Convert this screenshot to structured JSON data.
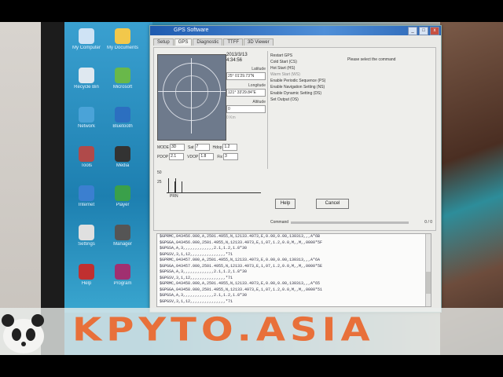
{
  "window": {
    "title": "GPS Software",
    "controls": [
      "_",
      "□",
      "x"
    ]
  },
  "tabs": [
    "Setup",
    "GPS",
    "Diagnostic",
    "TTFF",
    "3D Viewer"
  ],
  "fix_info": {
    "date": "2013/3/13",
    "time": "4:34:56",
    "latitude_label": "Latitude",
    "latitude_value": "25° 01'29.73\"N",
    "longitude_label": "Longitude",
    "longitude_value": "121° 33'29.84\"E",
    "altitude_label": "Altitude",
    "altitude_value": "0",
    "speed_text": "0  Km"
  },
  "status_row": {
    "mode_label": "MODE",
    "mode_value": "3D",
    "sats_label": "Sat",
    "sats_value": "7",
    "hdop_label": "Hdop",
    "hdop_value": "1.2",
    "pdop_label": "PDOP",
    "pdop_value": "2.1",
    "vdop_label": "VDOP",
    "vdop_value": "1.8",
    "fix_label": "Fix",
    "fix_value": "3"
  },
  "signal": {
    "label_top": "50",
    "label_mid": "25",
    "label_prn": "PRN"
  },
  "test_list": [
    "Restart GPS",
    "Cold Start (CS)",
    "Hot Start (HS)",
    "Warm Start (WS)",
    "Enable Periodic Sequence (PS)",
    "Enable Navigation Setting (NS)",
    "Enable Dynamic Setting (DS)",
    "Set Output (OS)"
  ],
  "selected_test_index": 3,
  "result_label": "Please select the command",
  "buttons": {
    "help": "Help",
    "cancel": "Cancel"
  },
  "progress": {
    "label": "Command",
    "value_text": "0 / 0",
    "fraction": 0
  },
  "log_lines": [
    "$GPRMC,043456.000,A,2501.4955,N,12133.4973,E,0.00,0.00,130313,,,A*6B",
    "$GPGGA,043456.000,2501.4955,N,12133.4973,E,1,07,1.2,0.0,M,,M,,0000*5F",
    "$GPGSA,A,3,,,,,,,,,,,,,2.1,1.2,1.8*30",
    "$GPGSV,3,1,12,,,,,,,,,,,,,,,*71",
    "$GPRMC,043457.000,A,2501.4955,N,12133.4973,E,0.00,0.00,130313,,,A*6A",
    "$GPGGA,043457.000,2501.4955,N,12133.4973,E,1,07,1.2,0.0,M,,M,,0000*5E",
    "$GPGSA,A,3,,,,,,,,,,,,,2.1,1.2,1.8*30",
    "$GPGSV,3,1,12,,,,,,,,,,,,,,,*71",
    "$GPRMC,043458.000,A,2501.4955,N,12133.4973,E,0.00,0.00,130313,,,A*65",
    "$GPGGA,043458.000,2501.4955,N,12133.4973,E,1,07,1.2,0.0,M,,M,,0000*51",
    "$GPGSA,A,3,,,,,,,,,,,,,2.1,1.2,1.8*30",
    "$GPGSV,3,1,12,,,,,,,,,,,,,,,*71"
  ],
  "desktop_icons": [
    {
      "label": "My Computer",
      "icon": "computer-icon",
      "color": "#cfe3f5"
    },
    {
      "label": "My Documents",
      "icon": "folder-icon",
      "color": "#f2c84b"
    },
    {
      "label": "Recycle Bin",
      "icon": "recycle-bin-icon",
      "color": "#dfe8f0"
    },
    {
      "label": "Microsoft",
      "icon": "app-icon",
      "color": "#69b84a"
    },
    {
      "label": "Network",
      "icon": "network-icon",
      "color": "#4aa3d8"
    },
    {
      "label": "Bluetooth",
      "icon": "bluetooth-icon",
      "color": "#2c6fc0"
    },
    {
      "label": "Tools",
      "icon": "tools-icon",
      "color": "#b04a4a"
    },
    {
      "label": "Media",
      "icon": "media-icon",
      "color": "#333333"
    },
    {
      "label": "Internet",
      "icon": "globe-icon",
      "color": "#3b7fd0"
    },
    {
      "label": "Player",
      "icon": "player-icon",
      "color": "#3aa04a"
    },
    {
      "label": "Settings",
      "icon": "settings-icon",
      "color": "#e0e0e0"
    },
    {
      "label": "Manager",
      "icon": "manager-icon",
      "color": "#555555"
    },
    {
      "label": "Help",
      "icon": "help-icon",
      "color": "#c03030"
    },
    {
      "label": "Program",
      "icon": "program-icon",
      "color": "#a03070"
    }
  ],
  "watermark": "KPYTO.ASIA",
  "colors": {
    "title_bar": "#2a64b4",
    "desktop": "#2a8fb8",
    "watermark": "#e8703a"
  }
}
